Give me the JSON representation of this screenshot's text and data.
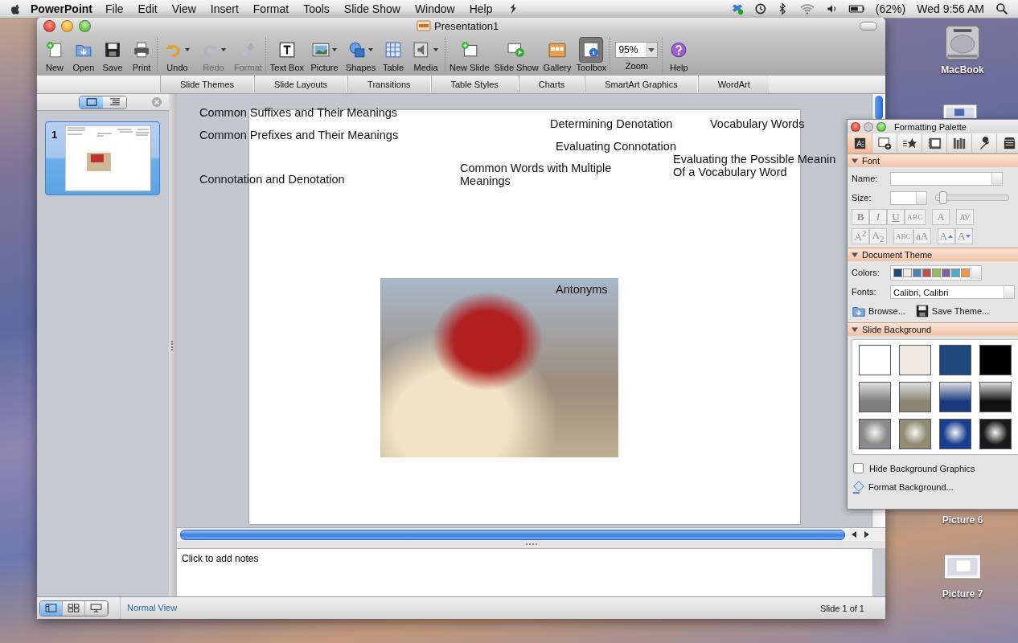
{
  "menu_bar": {
    "app": "PowerPoint",
    "menus": [
      "File",
      "Edit",
      "View",
      "Insert",
      "Format",
      "Tools",
      "Slide Show",
      "Window",
      "Help"
    ],
    "battery": "(62%)",
    "clock": "Wed 9:56 AM"
  },
  "window": {
    "title": "Presentation1"
  },
  "toolbar": [
    {
      "kind": "button",
      "label": "New",
      "disabled": false,
      "pressed": false,
      "dropdown": false
    },
    {
      "kind": "button",
      "label": "Open",
      "disabled": false,
      "pressed": false,
      "dropdown": false
    },
    {
      "kind": "button",
      "label": "Save",
      "disabled": false,
      "pressed": false,
      "dropdown": false
    },
    {
      "kind": "button",
      "label": "Print",
      "disabled": false,
      "pressed": false,
      "dropdown": false
    },
    {
      "kind": "button",
      "label": "Undo",
      "disabled": false,
      "pressed": false,
      "dropdown": true
    },
    {
      "kind": "button",
      "label": "Redo",
      "disabled": true,
      "pressed": false,
      "dropdown": true
    },
    {
      "kind": "button",
      "label": "Format",
      "disabled": true,
      "pressed": false,
      "dropdown": false
    },
    {
      "kind": "button",
      "label": "Text Box",
      "disabled": false,
      "pressed": false,
      "dropdown": false
    },
    {
      "kind": "button",
      "label": "Picture",
      "disabled": false,
      "pressed": false,
      "dropdown": true
    },
    {
      "kind": "button",
      "label": "Shapes",
      "disabled": false,
      "pressed": false,
      "dropdown": true
    },
    {
      "kind": "button",
      "label": "Table",
      "disabled": false,
      "pressed": false,
      "dropdown": false
    },
    {
      "kind": "button",
      "label": "Media",
      "disabled": false,
      "pressed": false,
      "dropdown": true
    },
    {
      "kind": "button",
      "label": "New Slide",
      "disabled": false,
      "pressed": false,
      "dropdown": false
    },
    {
      "kind": "button",
      "label": "Slide Show",
      "disabled": false,
      "pressed": false,
      "dropdown": false
    },
    {
      "kind": "button",
      "label": "Gallery",
      "disabled": false,
      "pressed": false,
      "dropdown": false
    },
    {
      "kind": "button",
      "label": "Toolbox",
      "disabled": false,
      "pressed": true,
      "dropdown": false
    },
    {
      "kind": "zoom",
      "label": "Zoom",
      "value": "95%"
    },
    {
      "kind": "button",
      "label": "Help",
      "disabled": false,
      "pressed": false,
      "dropdown": false
    }
  ],
  "ribbon_tabs": [
    {
      "label": "Slide Themes",
      "selected": false
    },
    {
      "label": "Slide Layouts",
      "selected": false
    },
    {
      "label": "Transitions",
      "selected": false
    },
    {
      "label": "Table Styles",
      "selected": false
    },
    {
      "label": "Charts",
      "selected": false
    },
    {
      "label": "SmartArt Graphics",
      "selected": false
    },
    {
      "label": "WordArt",
      "selected": false
    }
  ],
  "sidebar": {
    "views": [
      {
        "kind": "slides",
        "selected": true
      },
      {
        "kind": "outline",
        "selected": false
      }
    ],
    "slides": [
      {
        "number": "1",
        "selected": true
      }
    ]
  },
  "slide": {
    "text_boxes": [
      "Common Suffixes and Their Meanings",
      "Common Prefixes and Their Meanings",
      "Connotation and Denotation",
      "Determining Denotation",
      "Vocabulary Words",
      "Evaluating Connotation",
      "Common Words with Multiple Meanings",
      "Evaluating the Possible Meanin\nOf a Vocabulary Word"
    ],
    "picture_caption": "Antonyms"
  },
  "notes": {
    "placeholder": "Click to add notes"
  },
  "status_bar": {
    "views": [
      {
        "kind": "normal",
        "selected": true
      },
      {
        "kind": "sorter",
        "selected": false
      },
      {
        "kind": "show",
        "selected": false
      }
    ],
    "view_name": "Normal View",
    "slide_count": "Slide 1 of 1"
  },
  "formatting_palette": {
    "title": "Formatting Palette",
    "tabs": [
      {
        "selected": true
      },
      {
        "selected": false
      },
      {
        "selected": false
      },
      {
        "selected": false
      },
      {
        "selected": false
      },
      {
        "selected": false
      },
      {
        "selected": false
      }
    ],
    "font": {
      "title": "Font",
      "expanded": true,
      "name_label": "Name:",
      "size_label": "Size:",
      "size_slider": {
        "level": 0.05
      },
      "buttons": [
        {
          "label": "B",
          "disabled": true
        },
        {
          "label": "I",
          "disabled": true
        },
        {
          "label": "U",
          "disabled": true
        },
        {
          "label": "ABC",
          "disabled": true
        },
        {
          "label": "A",
          "disabled": true
        },
        {
          "label": "AV",
          "disabled": true
        },
        {
          "label": "A$^{2}$",
          "disabled": true
        },
        {
          "label": "A$_{2}$",
          "disabled": true
        },
        {
          "label": "ABC",
          "disabled": true
        },
        {
          "label": "aA",
          "disabled": true
        },
        {
          "label": "A",
          "disabled": true
        },
        {
          "label": "A",
          "disabled": true
        }
      ]
    },
    "document_theme": {
      "title": "Document Theme",
      "expanded": true,
      "colors_label": "Colors:",
      "theme_colors": [
        {
          "color": "#1f497d"
        },
        {
          "color": "#eeece1"
        },
        {
          "color": "#4f81bd"
        },
        {
          "color": "#c0504d"
        },
        {
          "color": "#9bbb59"
        },
        {
          "color": "#8064a2"
        },
        {
          "color": "#4bacc6"
        },
        {
          "color": "#f79646"
        }
      ],
      "fonts_label": "Fonts:",
      "fonts_value": "Calibri, Calibri",
      "browse": "Browse...",
      "save_theme": "Save Theme..."
    },
    "slide_background": {
      "title": "Slide Background",
      "expanded": true,
      "swatches": [
        {
          "kind": "solid",
          "color": "#ffffff"
        },
        {
          "kind": "solid",
          "color": "#eeece1"
        },
        {
          "kind": "solid",
          "color": "#1f497d"
        },
        {
          "kind": "solid",
          "color": "#000000"
        },
        {
          "kind": "linear",
          "color": "#7f7f7f"
        },
        {
          "kind": "linear",
          "color": "#8a8670"
        },
        {
          "kind": "linear",
          "color": "#1a3a80"
        },
        {
          "kind": "linear",
          "color": "#111111"
        },
        {
          "kind": "radial",
          "color": "#8a8a8a"
        },
        {
          "kind": "radial",
          "color": "#8f8a70"
        },
        {
          "kind": "radial",
          "color": "#173f8e"
        },
        {
          "kind": "radial",
          "color": "#1a1a1a"
        }
      ],
      "hide_graphics": {
        "label": "Hide Background Graphics",
        "checked": false
      },
      "format_background": "Format Background..."
    }
  },
  "desktop": {
    "icons": [
      {
        "kind": "drive",
        "label": "MacBook"
      },
      {
        "kind": "picture",
        "label": "Picture 6"
      },
      {
        "kind": "picture",
        "label": "Picture 7"
      }
    ]
  }
}
